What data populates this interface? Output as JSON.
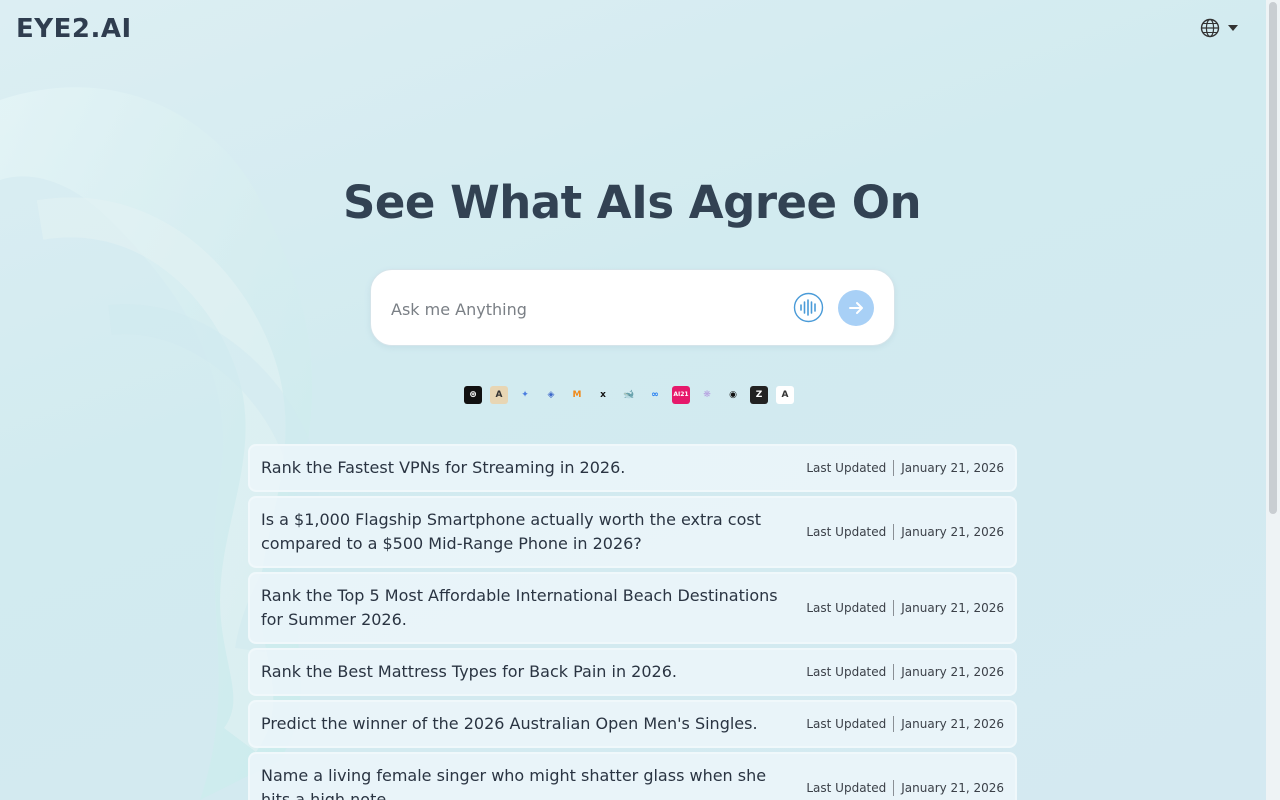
{
  "header": {
    "logo": "EYE2.AI",
    "language_icon": "globe-icon",
    "language_caret_icon": "caret-down-icon"
  },
  "hero": {
    "title": "See What AIs Agree On"
  },
  "search": {
    "placeholder": "Ask me Anything",
    "value": "",
    "voice_icon": "voice-wave-icon",
    "send_icon": "arrow-right-icon"
  },
  "models": [
    {
      "name": "chatgpt",
      "glyph": "⊛",
      "bg": "#111111",
      "fg": "#ffffff"
    },
    {
      "name": "anthropic",
      "glyph": "A",
      "bg": "#e8d6b4",
      "fg": "#333333"
    },
    {
      "name": "gemini",
      "glyph": "✦",
      "bg": "transparent",
      "fg": "#4a7de0"
    },
    {
      "name": "perplexity",
      "glyph": "◈",
      "bg": "transparent",
      "fg": "#3a66c9"
    },
    {
      "name": "mistral",
      "glyph": "M",
      "bg": "transparent",
      "fg": "#f08a1a"
    },
    {
      "name": "grok",
      "glyph": "x",
      "bg": "transparent",
      "fg": "#111111"
    },
    {
      "name": "deepseek",
      "glyph": "🐋",
      "bg": "transparent",
      "fg": "#4a62d8"
    },
    {
      "name": "meta",
      "glyph": "∞",
      "bg": "transparent",
      "fg": "#1877f2"
    },
    {
      "name": "ai21",
      "glyph": "AI21",
      "bg": "#e6196b",
      "fg": "#ffffff"
    },
    {
      "name": "qwen",
      "glyph": "❋",
      "bg": "transparent",
      "fg": "#b59ee0"
    },
    {
      "name": "cohere",
      "glyph": "◉",
      "bg": "transparent",
      "fg": "#111111"
    },
    {
      "name": "zhipu",
      "glyph": "Z",
      "bg": "#222222",
      "fg": "#ffffff"
    },
    {
      "name": "amazon",
      "glyph": "A",
      "bg": "#ffffff",
      "fg": "#333333"
    }
  ],
  "questions": [
    {
      "title": "Rank the Fastest VPNs for Streaming in 2026.",
      "updated_label": "Last Updated",
      "date": "January 21, 2026"
    },
    {
      "title": "Is a $1,000 Flagship Smartphone actually worth the extra cost compared to a $500 Mid-Range Phone in 2026?",
      "updated_label": "Last Updated",
      "date": "January 21, 2026"
    },
    {
      "title": "Rank the Top 5 Most Affordable International Beach Destinations for Summer 2026.",
      "updated_label": "Last Updated",
      "date": "January 21, 2026"
    },
    {
      "title": "Rank the Best Mattress Types for Back Pain in 2026.",
      "updated_label": "Last Updated",
      "date": "January 21, 2026"
    },
    {
      "title": "Predict the winner of the 2026 Australian Open Men's Singles.",
      "updated_label": "Last Updated",
      "date": "January 21, 2026"
    },
    {
      "title": "Name a living female singer who might shatter glass when she hits a high note.",
      "updated_label": "Last Updated",
      "date": "January 21, 2026"
    }
  ],
  "colors": {
    "accent": "#a8d0f6",
    "title": "#324253",
    "background": "#d2ebf0"
  }
}
